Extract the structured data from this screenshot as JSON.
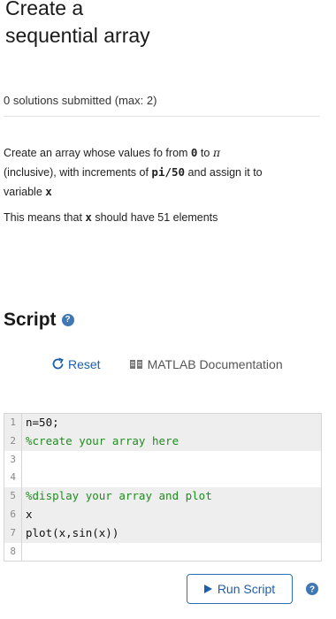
{
  "title_lines": [
    "Create a",
    "sequential array"
  ],
  "submissions": "0 solutions submitted (max: 2)",
  "description": {
    "part1": "Create an array whose values fo from ",
    "code_zero": "0",
    "part2": " to ",
    "pi": "π",
    "part3": " (inclusive), with increments of ",
    "code_step": "pi/50",
    "part4": " and assign it to variable ",
    "code_var": "x"
  },
  "note": {
    "part1": "This means that ",
    "code_var": "x",
    "part2": " should have 51 elements"
  },
  "script": {
    "heading": "Script",
    "help_icon": "question-icon",
    "reset_label": "Reset",
    "doc_label": "MATLAB Documentation",
    "lines": [
      {
        "num": "1",
        "text": "n=50;",
        "comment": false,
        "shade": true
      },
      {
        "num": "2",
        "text": "%create your array here",
        "comment": true,
        "shade": true
      },
      {
        "num": "3",
        "text": "",
        "comment": false,
        "shade": false
      },
      {
        "num": "4",
        "text": "",
        "comment": false,
        "shade": false
      },
      {
        "num": "5",
        "text": "%display your array and plot",
        "comment": true,
        "shade": true
      },
      {
        "num": "6",
        "text": "x",
        "comment": false,
        "shade": true
      },
      {
        "num": "7",
        "text": "plot(x,sin(x))",
        "comment": false,
        "shade": true
      },
      {
        "num": "8",
        "text": "",
        "comment": false,
        "shade": false
      }
    ],
    "run_label": "Run Script"
  },
  "colors": {
    "accent": "#1f5fa8",
    "help_icon": "#3f78b5",
    "comment": "#228b22",
    "shaded_line": "#eeeeee"
  }
}
